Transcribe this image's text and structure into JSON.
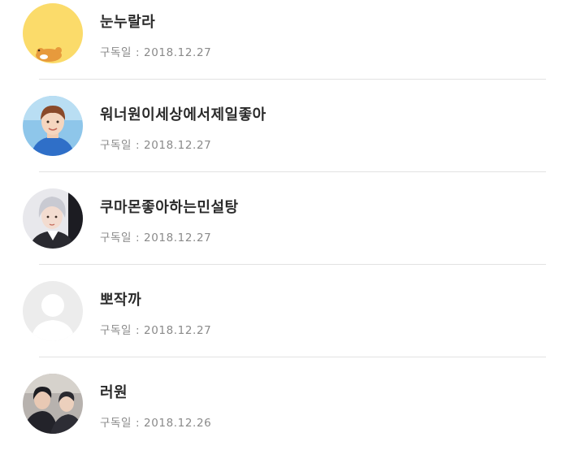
{
  "subscribers": [
    {
      "name": "눈누랄라",
      "label": "구독일",
      "separator": ":",
      "date": "2018.12.27",
      "avatar": "yellow-character-icon"
    },
    {
      "name": "워너원이세상에서제일좋아",
      "label": "구독일",
      "separator": ":",
      "date": "2018.12.27",
      "avatar": "profile-photo"
    },
    {
      "name": "쿠마몬좋아하는민설탕",
      "label": "구독일",
      "separator": ":",
      "date": "2018.12.27",
      "avatar": "profile-photo"
    },
    {
      "name": "뽀작까",
      "label": "구독일",
      "separator": ":",
      "date": "2018.12.27",
      "avatar": "default-person-icon"
    },
    {
      "name": "러원",
      "label": "구독일",
      "separator": ":",
      "date": "2018.12.26",
      "avatar": "profile-photo"
    }
  ]
}
